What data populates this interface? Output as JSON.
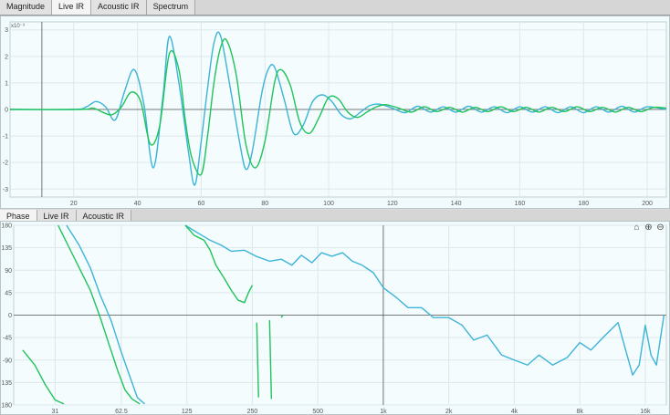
{
  "top_tabs": [
    {
      "label": "Magnitude",
      "active": false
    },
    {
      "label": "Live IR",
      "active": true
    },
    {
      "label": "Acoustic IR",
      "active": false
    },
    {
      "label": "Spectrum",
      "active": false
    }
  ],
  "bottom_tabs": [
    {
      "label": "Phase",
      "active": true
    },
    {
      "label": "Live IR",
      "active": false
    },
    {
      "label": "Acoustic IR",
      "active": false
    }
  ],
  "toolbar_icons": [
    "home-icon",
    "zoom-in-icon",
    "zoom-out-icon"
  ],
  "colors": {
    "series_blue": "#3cb4d8",
    "series_green": "#1ec45a",
    "plot_bg": "#f1fbfd"
  },
  "chart_data": [
    {
      "type": "line",
      "title": "",
      "y_exponent_label": "x10⁻³",
      "xlim": [
        0,
        206
      ],
      "ylim": [
        -3.3,
        3.3
      ],
      "x_ticks": [
        20,
        40,
        60,
        80,
        100,
        120,
        140,
        160,
        180,
        200
      ],
      "x_tick_labels": [
        "20",
        "40",
        "60",
        "80",
        "100",
        "120",
        "140",
        "160",
        "180",
        "200"
      ],
      "y_ticks": [
        3,
        2,
        1,
        0,
        -1,
        -2,
        -3
      ],
      "y_tick_labels": [
        "3",
        "2",
        "1",
        "0",
        "-1",
        "-2",
        "-3"
      ],
      "cursor_x": 10,
      "grid": true,
      "series": [
        {
          "color": "#3cb4d8",
          "x": [
            0,
            20,
            24,
            27,
            30,
            33,
            36,
            39,
            42,
            45,
            48,
            50,
            53,
            56,
            58,
            60,
            62,
            64,
            66,
            69,
            72,
            74,
            76,
            79,
            81,
            83,
            86,
            89,
            92,
            95,
            98,
            101,
            104,
            107,
            110,
            113,
            116,
            120,
            124,
            128,
            132,
            136,
            140,
            144,
            148,
            152,
            156,
            160,
            164,
            168,
            172,
            176,
            180,
            184,
            188,
            192,
            196,
            200,
            206
          ],
          "y": [
            0,
            0,
            0.1,
            0.3,
            0.1,
            -0.4,
            0.7,
            1.5,
            0.2,
            -2.2,
            0.5,
            2.75,
            1.0,
            -1.6,
            -2.85,
            -1.2,
            0.8,
            2.5,
            2.8,
            0.9,
            -1.2,
            -2.25,
            -1.6,
            0.6,
            1.5,
            1.6,
            0.4,
            -0.9,
            -0.6,
            0.3,
            0.55,
            0.3,
            -0.2,
            -0.35,
            -0.1,
            0.15,
            0.2,
            0.05,
            -0.12,
            0.12,
            -0.1,
            0.1,
            -0.1,
            0.12,
            -0.1,
            0.1,
            -0.12,
            0.1,
            -0.1,
            0.1,
            -0.12,
            0.1,
            -0.12,
            0.1,
            -0.1,
            0.12,
            -0.1,
            0.1,
            0
          ]
        },
        {
          "color": "#1ec45a",
          "x": [
            0,
            22,
            26,
            29,
            32,
            35,
            38,
            41,
            44,
            47,
            50,
            53,
            55,
            57,
            60,
            62,
            64,
            66,
            68,
            71,
            74,
            77,
            80,
            83,
            85,
            88,
            91,
            94,
            97,
            100,
            103,
            106,
            109,
            112,
            115,
            118,
            122,
            126,
            130,
            134,
            138,
            142,
            146,
            150,
            154,
            158,
            162,
            166,
            170,
            174,
            178,
            182,
            186,
            190,
            194,
            198,
            202,
            206
          ],
          "y": [
            0,
            0,
            0.05,
            -0.1,
            -0.2,
            0.1,
            0.65,
            0.3,
            -1.3,
            -0.6,
            2.1,
            1.5,
            -0.4,
            -1.8,
            -2.45,
            -1.0,
            1.0,
            2.3,
            2.6,
            1.3,
            -1.3,
            -2.2,
            -1.2,
            1.0,
            1.5,
            0.9,
            -0.5,
            -0.9,
            -0.3,
            0.45,
            0.4,
            -0.1,
            -0.3,
            -0.1,
            0.1,
            0.18,
            0.05,
            -0.1,
            0.1,
            -0.08,
            0.08,
            -0.1,
            0.08,
            -0.08,
            0.1,
            -0.08,
            0.08,
            -0.1,
            0.08,
            -0.08,
            0.1,
            -0.08,
            0.08,
            -0.1,
            0.08,
            -0.08,
            0.08,
            0.05
          ]
        }
      ]
    },
    {
      "type": "line",
      "title": "",
      "x_scale": "log",
      "xlim": [
        20,
        20000
      ],
      "ylim": [
        -180,
        180
      ],
      "x_ticks": [
        31,
        62.5,
        125,
        250,
        500,
        1000,
        2000,
        4000,
        8000,
        16000
      ],
      "x_tick_labels": [
        "31",
        "62.5",
        "125",
        "250",
        "500",
        "1k",
        "2k",
        "4k",
        "8k",
        "16k"
      ],
      "y_ticks": [
        180,
        135,
        90,
        45,
        0,
        -45,
        -90,
        -135,
        -180
      ],
      "y_tick_labels": [
        "180",
        "135",
        "90",
        "45",
        "0",
        "-45",
        "-90",
        "-135",
        "-180"
      ],
      "cursor_x": 1000,
      "grid": true,
      "series": [
        {
          "color": "#3cb4d8",
          "segments": [
            {
              "x": [
                35,
                40,
                45,
                50,
                56,
                62,
                68,
                74,
                80
              ],
              "y": [
                180,
                140,
                95,
                40,
                -10,
                -70,
                -120,
                -165,
                -178
              ]
            },
            {
              "x": [
                123,
                140,
                160,
                180,
                200,
                230,
                260,
                300,
                340,
                380,
                420,
                470,
                520,
                580,
                650,
                720,
                800,
                900,
                1000,
                1150,
                1300,
                1500,
                1700,
                2000,
                2300,
                2600,
                3000,
                3500,
                4000,
                4600,
                5200,
                6000,
                7000,
                8000,
                9000,
                10500,
                12000,
                13000,
                14000,
                15000,
                16000,
                17000,
                18000,
                19500
              ],
              "y": [
                180,
                165,
                150,
                140,
                128,
                130,
                118,
                108,
                112,
                100,
                120,
                105,
                125,
                118,
                125,
                108,
                100,
                85,
                55,
                35,
                15,
                15,
                -5,
                -5,
                -20,
                -50,
                -40,
                -80,
                -90,
                -100,
                -80,
                -100,
                -85,
                -55,
                -70,
                -40,
                -15,
                -70,
                -120,
                -100,
                -20,
                -80,
                -100,
                0
              ]
            }
          ]
        },
        {
          "color": "#1ec45a",
          "segments": [
            {
              "x": [
                22,
                25,
                28,
                31,
                34
              ],
              "y": [
                -70,
                -100,
                -140,
                -170,
                -178
              ]
            },
            {
              "x": [
                32,
                36,
                40,
                45,
                50,
                55,
                60,
                65,
                70,
                76
              ],
              "y": [
                180,
                135,
                95,
                50,
                -5,
                -60,
                -110,
                -150,
                -168,
                -178
              ]
            },
            {
              "x": [
                123,
                135,
                150,
                160,
                170,
                185,
                200,
                215,
                230,
                240,
                250
              ],
              "y": [
                180,
                160,
                150,
                130,
                100,
                75,
                50,
                30,
                25,
                45,
                60
              ]
            },
            {
              "x": [
                262,
                267
              ],
              "y": [
                -15,
                -165
              ]
            },
            {
              "x": [
                300,
                306
              ],
              "y": [
                -10,
                -168
              ]
            },
            {
              "x": [
                340,
                345
              ],
              "y": [
                -5,
                0
              ]
            }
          ]
        }
      ]
    }
  ]
}
